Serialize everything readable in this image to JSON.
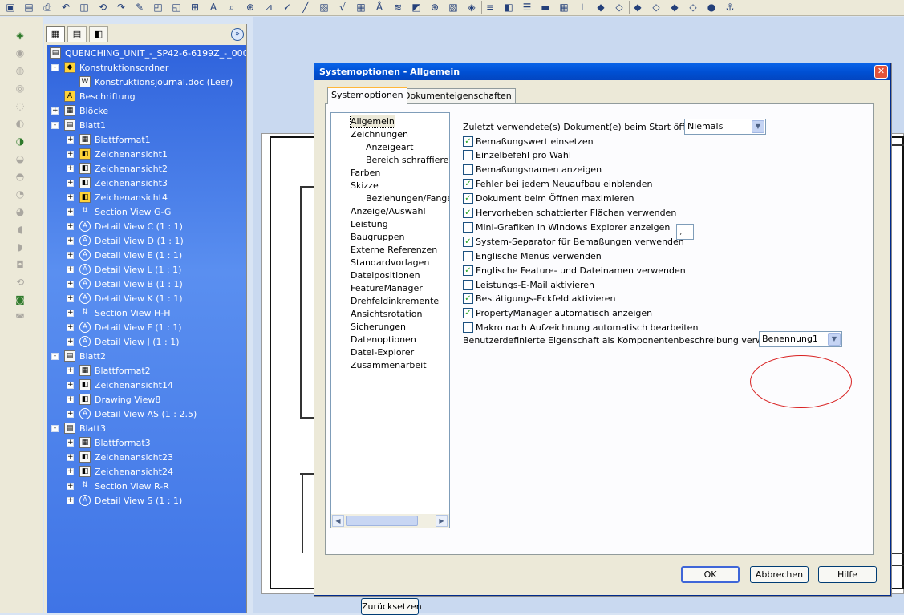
{
  "toolbar": {
    "icons": [
      "open-icon",
      "save-icon",
      "print-icon",
      "undo-icon",
      "smart-dimension-icon",
      "rebuild-icon",
      "redo-icon",
      "note-icon",
      "balloon-icon",
      "weld-icon",
      "datum-icon",
      "text-icon",
      "search-icon",
      "zoom-icon",
      "geometric-tolerance-icon",
      "check-icon",
      "line-icon",
      "hatch-icon",
      "surface-finish-icon",
      "table-icon",
      "text-a-icon",
      "cosmetic-thread-icon",
      "area-hatch-icon",
      "center-mark-icon",
      "block-icon",
      "revision-icon",
      "layer-icon",
      "view-icon",
      "line-style-icon",
      "line-thickness-icon",
      "grid-icon",
      "align-icon",
      "3d-view-icon",
      "box-icon",
      "cube-icon",
      "cube2-icon",
      "cube3-icon",
      "cube4-icon",
      "hide-icon",
      "anchor-icon"
    ]
  },
  "left_toolbar": {
    "icons": [
      "model-view-icon",
      "projected-view-icon",
      "auxiliary-view-icon",
      "section-view-icon",
      "aligned-section-icon",
      "detail-view-icon",
      "broken-out-icon",
      "break-icon",
      "crop-view-icon",
      "alternate-position-icon",
      "relative-view-icon",
      "predefined-view-icon",
      "empty-view-icon",
      "flat-pattern-icon",
      "update-view-icon",
      "drawing-tools-icon",
      "options-icon"
    ]
  },
  "feature_manager": {
    "root": "QUENCHING_UNIT_-_SP42-6-6199Z_-_000",
    "items": [
      {
        "label": "Konstruktionsordner",
        "level": 1,
        "expander": "-",
        "icon": "folder-icon"
      },
      {
        "label": "Konstruktionsjournal.doc (Leer)",
        "level": 2,
        "expander": "",
        "icon": "word-document-icon"
      },
      {
        "label": "Beschriftung",
        "level": 1,
        "expander": "",
        "icon": "annotation-icon"
      },
      {
        "label": "Blöcke",
        "level": 1,
        "expander": "+",
        "icon": "blocks-icon"
      },
      {
        "label": "Blatt1",
        "level": 1,
        "expander": "-",
        "icon": "sheet-icon"
      },
      {
        "label": "Blattformat1",
        "level": 2,
        "expander": "+",
        "icon": "sheet-format-icon"
      },
      {
        "label": "Zeichenansicht1",
        "level": 2,
        "expander": "+",
        "icon": "drawing-view-icon"
      },
      {
        "label": "Zeichenansicht2",
        "level": 2,
        "expander": "+",
        "icon": "drawing-view-icon"
      },
      {
        "label": "Zeichenansicht3",
        "level": 2,
        "expander": "+",
        "icon": "drawing-view-icon"
      },
      {
        "label": "Zeichenansicht4",
        "level": 2,
        "expander": "+",
        "icon": "drawing-view-icon"
      },
      {
        "label": "Section View G-G",
        "level": 2,
        "expander": "+",
        "icon": "section-view-icon"
      },
      {
        "label": "Detail View C (1 : 1)",
        "level": 2,
        "expander": "+",
        "icon": "detail-view-icon"
      },
      {
        "label": "Detail View D (1 : 1)",
        "level": 2,
        "expander": "+",
        "icon": "detail-view-icon"
      },
      {
        "label": "Detail View E (1 : 1)",
        "level": 2,
        "expander": "+",
        "icon": "detail-view-icon"
      },
      {
        "label": "Detail View L (1 : 1)",
        "level": 2,
        "expander": "+",
        "icon": "detail-view-icon"
      },
      {
        "label": "Detail View B (1 : 1)",
        "level": 2,
        "expander": "+",
        "icon": "detail-view-icon"
      },
      {
        "label": "Detail View K (1 : 1)",
        "level": 2,
        "expander": "+",
        "icon": "detail-view-icon"
      },
      {
        "label": "Section View H-H",
        "level": 2,
        "expander": "+",
        "icon": "section-view-icon"
      },
      {
        "label": "Detail View F (1 : 1)",
        "level": 2,
        "expander": "+",
        "icon": "detail-view-icon"
      },
      {
        "label": "Detail View J (1 : 1)",
        "level": 2,
        "expander": "+",
        "icon": "detail-view-icon"
      },
      {
        "label": "Blatt2",
        "level": 1,
        "expander": "-",
        "icon": "sheet-icon"
      },
      {
        "label": "Blattformat2",
        "level": 2,
        "expander": "+",
        "icon": "sheet-format-icon"
      },
      {
        "label": "Zeichenansicht14",
        "level": 2,
        "expander": "+",
        "icon": "drawing-view-icon"
      },
      {
        "label": "Drawing View8",
        "level": 2,
        "expander": "+",
        "icon": "drawing-view-icon"
      },
      {
        "label": "Detail View AS (1 : 2.5)",
        "level": 2,
        "expander": "+",
        "icon": "detail-view-icon"
      },
      {
        "label": "Blatt3",
        "level": 1,
        "expander": "-",
        "icon": "sheet-icon"
      },
      {
        "label": "Blattformat3",
        "level": 2,
        "expander": "+",
        "icon": "sheet-format-icon"
      },
      {
        "label": "Zeichenansicht23",
        "level": 2,
        "expander": "+",
        "icon": "drawing-view-icon"
      },
      {
        "label": "Zeichenansicht24",
        "level": 2,
        "expander": "+",
        "icon": "drawing-view-icon"
      },
      {
        "label": "Section View R-R",
        "level": 2,
        "expander": "+",
        "icon": "section-view-icon"
      },
      {
        "label": "Detail View S (1 : 1)",
        "level": 2,
        "expander": "+",
        "icon": "detail-view-icon"
      }
    ]
  },
  "dialog": {
    "title": "Systemoptionen - Allgemein",
    "tabs": [
      "Systemoptionen",
      "Dokumenteigenschaften"
    ],
    "nav": [
      {
        "label": "Allgemein",
        "level": 1,
        "selected": true
      },
      {
        "label": "Zeichnungen",
        "level": 1
      },
      {
        "label": "Anzeigeart",
        "level": 2
      },
      {
        "label": "Bereich schraffieren/",
        "level": 2
      },
      {
        "label": "Farben",
        "level": 1
      },
      {
        "label": "Skizze",
        "level": 1
      },
      {
        "label": "Beziehungen/Fangen",
        "level": 2
      },
      {
        "label": "Anzeige/Auswahl",
        "level": 1
      },
      {
        "label": "Leistung",
        "level": 1
      },
      {
        "label": "Baugruppen",
        "level": 1
      },
      {
        "label": "Externe Referenzen",
        "level": 1
      },
      {
        "label": "Standardvorlagen",
        "level": 1
      },
      {
        "label": "Dateipositionen",
        "level": 1
      },
      {
        "label": "FeatureManager",
        "level": 1
      },
      {
        "label": "Drehfeldinkremente",
        "level": 1
      },
      {
        "label": "Ansichtsrotation",
        "level": 1
      },
      {
        "label": "Sicherungen",
        "level": 1
      },
      {
        "label": "Datenoptionen",
        "level": 1
      },
      {
        "label": "Datei-Explorer",
        "level": 1
      },
      {
        "label": "Zusammenarbeit",
        "level": 1
      }
    ],
    "last_docs_label": "Zuletzt verwendete(s) Dokument(e) beim Start öffnen:",
    "last_docs_value": "Niemals",
    "options": [
      {
        "label": "Bemaßungswert einsetzen",
        "checked": true
      },
      {
        "label": "Einzelbefehl pro Wahl",
        "checked": false
      },
      {
        "label": "Bemaßungsnamen anzeigen",
        "checked": false
      },
      {
        "label": "Fehler bei jedem Neuaufbau einblenden",
        "checked": true
      },
      {
        "label": "Dokument beim Öffnen maximieren",
        "checked": true
      },
      {
        "label": "Hervorheben schattierter Flächen verwenden",
        "checked": true
      },
      {
        "label": "Mini-Grafiken in Windows Explorer anzeigen",
        "checked": false
      },
      {
        "label": "System-Separator für Bemaßungen verwenden",
        "checked": true
      },
      {
        "label": "Englische Menüs verwenden",
        "checked": false
      },
      {
        "label": "Englische Feature- und Dateinamen verwenden",
        "checked": true
      },
      {
        "label": "Leistungs-E-Mail aktivieren",
        "checked": false
      },
      {
        "label": "Bestätigungs-Eckfeld aktivieren",
        "checked": true
      },
      {
        "label": "PropertyManager automatisch anzeigen",
        "checked": true
      },
      {
        "label": "Makro nach Aufzeichnung automatisch bearbeiten",
        "checked": false
      }
    ],
    "separator_value": ",",
    "custom_prop_label": "Benutzerdefinierte Eigenschaft als Komponentenbeschreibung verwendet:",
    "custom_prop_value": "Benennung1",
    "reset_label": "Zurücksetzen",
    "ok_label": "OK",
    "cancel_label": "Abbrechen",
    "help_label": "Hilfe"
  }
}
